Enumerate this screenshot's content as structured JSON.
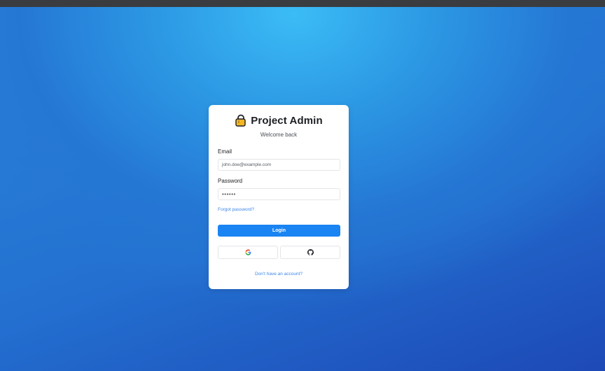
{
  "brand": {
    "title": "Project Admin",
    "icon": "lock-icon"
  },
  "subtitle": "Welcome back",
  "form": {
    "email_label": "Email",
    "email_value": "john.doe@example.com",
    "password_label": "Password",
    "password_value": "••••••",
    "forgot_link": "Forgot password?",
    "login_button": "Login"
  },
  "social": {
    "google_icon": "google-icon",
    "github_icon": "github-icon"
  },
  "signup_link": "Don't have an account?",
  "colors": {
    "accent": "#1a84f3",
    "link": "#3d86e8",
    "background_top": "#3bbcf6",
    "background_bottom": "#1d49b6"
  }
}
